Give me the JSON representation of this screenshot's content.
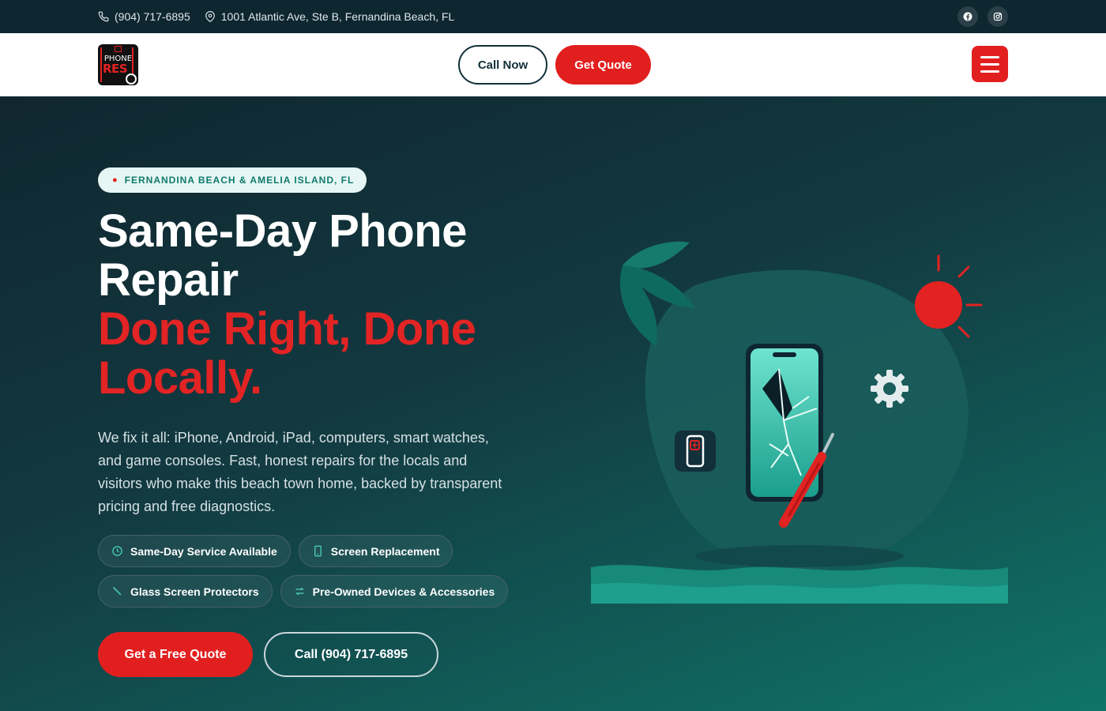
{
  "topbar": {
    "phone": "(904) 717-6895",
    "address": "1001 Atlantic Ave, Ste B, Fernandina Beach, FL",
    "social": [
      "facebook-icon",
      "instagram-icon"
    ]
  },
  "header": {
    "logo_top": "PHONE",
    "logo_bottom": "RES",
    "call_label": "Call Now",
    "quote_label": "Get Quote"
  },
  "hero": {
    "location": "FERNANDINA BEACH & AMELIA ISLAND, FL",
    "title_line1": "Same-Day Phone Repair",
    "title_accent": "Done Right, Done Locally.",
    "lead": "We fix it all: iPhone, Android, iPad, computers, smart watches, and game consoles. Fast, honest repairs for the locals and visitors who make this beach town home, backed by transparent pricing and free diagnostics.",
    "tags": [
      {
        "label": "Same-Day Service Available",
        "icon": "clock-icon"
      },
      {
        "label": "Screen Replacement",
        "icon": "phone-icon"
      },
      {
        "label": "Glass Screen Protectors",
        "icon": "screwdriver-icon"
      },
      {
        "label": "Pre-Owned Devices & Accessories",
        "icon": "exchange-icon"
      }
    ],
    "cta_primary": "Get a Free Quote",
    "cta_secondary": "Call (904) 717-6895"
  },
  "colors": {
    "accent": "#e21f1f",
    "teal": "#1e9e8c",
    "dark": "#0e2630"
  }
}
